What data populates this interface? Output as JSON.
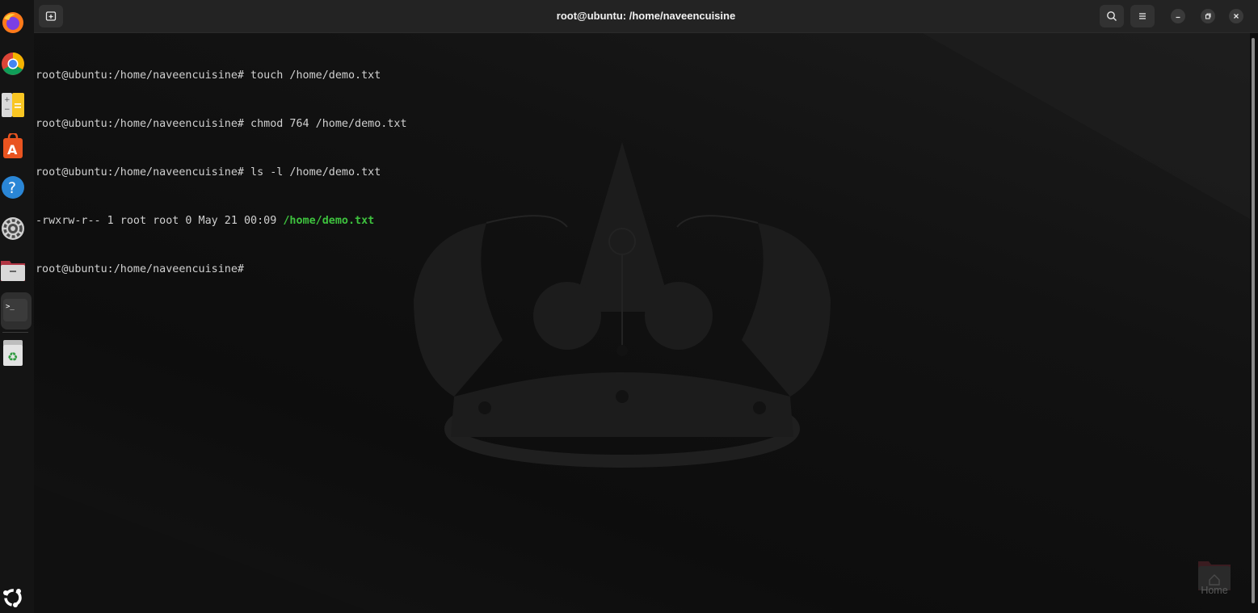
{
  "window": {
    "title": "root@ubuntu: /home/naveencuisine"
  },
  "terminal": {
    "lines": [
      {
        "prompt": "root@ubuntu:/home/naveencuisine#",
        "command": " touch /home/demo.txt"
      },
      {
        "prompt": "root@ubuntu:/home/naveencuisine#",
        "command": " chmod 764 /home/demo.txt"
      },
      {
        "prompt": "root@ubuntu:/home/naveencuisine#",
        "command": " ls -l /home/demo.txt"
      },
      {
        "output": "-rwxrw-r-- 1 root root 0 May 21 00:09 ",
        "highlight": "/home/demo.txt"
      },
      {
        "prompt": "root@ubuntu:/home/naveencuisine#",
        "command": ""
      }
    ],
    "highlight_color": "#3ec23e"
  },
  "dock": {
    "items": [
      "firefox-icon",
      "chrome-icon",
      "text-editor-icon",
      "app-center-icon",
      "help-icon",
      "settings-icon",
      "files-icon",
      "terminal-icon",
      "trash-icon",
      "show-apps-icon"
    ]
  },
  "desktop": {
    "home_label": "Home"
  },
  "colors": {
    "titlebar": "#232323",
    "terminal_bg": "#0e0e0e",
    "text": "#d0d0d0"
  }
}
